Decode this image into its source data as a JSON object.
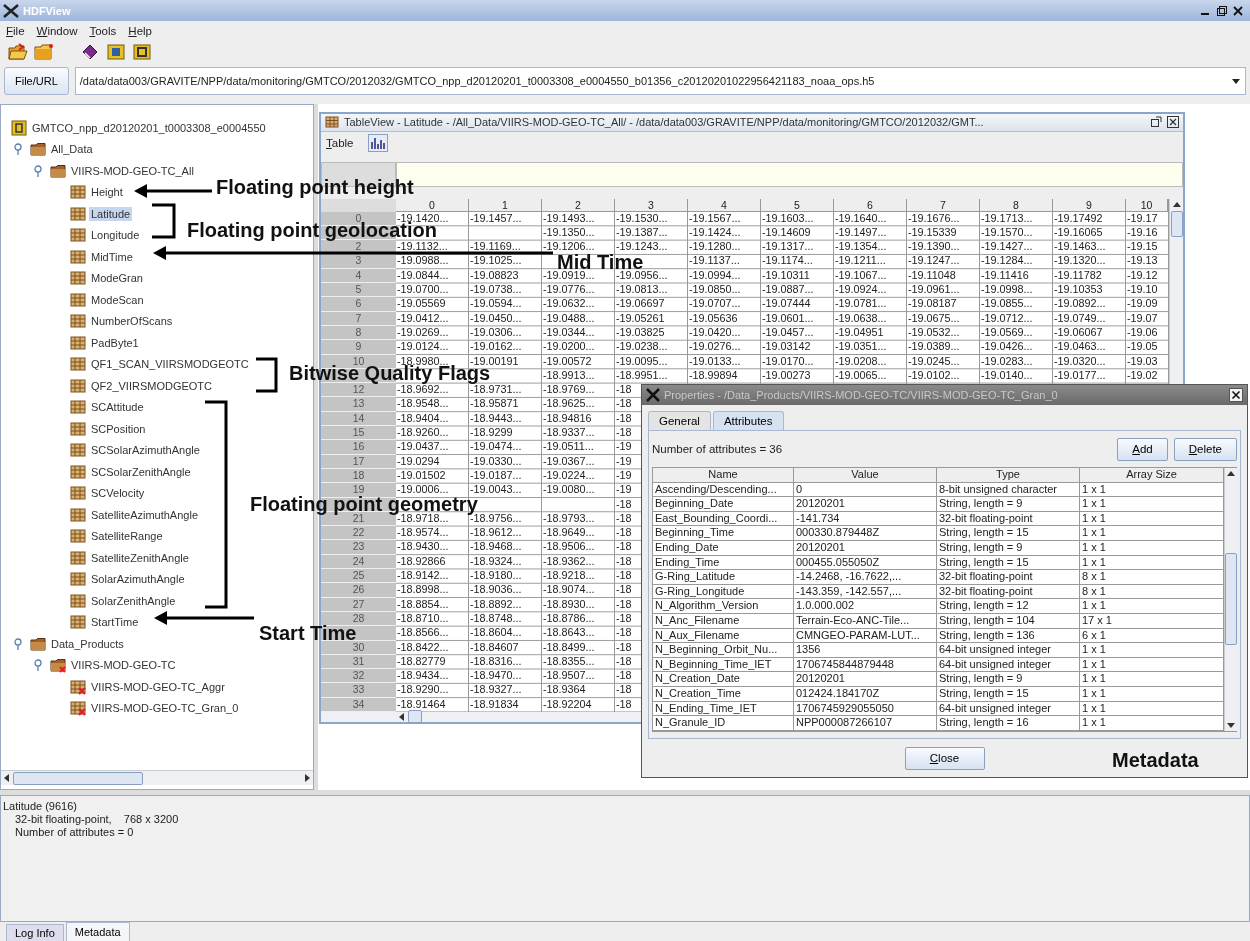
{
  "window": {
    "title": "HDFView"
  },
  "menu": [
    "File",
    "Window",
    "Tools",
    "Help"
  ],
  "file_url": {
    "label": "File/URL",
    "value": "/data/data003/GRAVITE/NPP/data/monitoring/GMTCO/2012032/GMTCO_npp_d20120201_t0003308_e0004550_b01356_c20120201022956421183_noaa_ops.h5"
  },
  "tree": {
    "items": [
      {
        "label": "GMTCO_npp_d20120201_t0003308_e0004550",
        "kind": "file",
        "selected": false,
        "children": [
          {
            "label": "All_Data",
            "kind": "group",
            "expanded": true,
            "selected": false,
            "children": [
              {
                "label": "VIIRS-MOD-GEO-TC_All",
                "kind": "group",
                "expanded": true,
                "selected": false,
                "children": [
                  {
                    "label": "Height",
                    "kind": "dataset",
                    "selected": false
                  },
                  {
                    "label": "Latitude",
                    "kind": "dataset",
                    "selected": true
                  },
                  {
                    "label": "Longitude",
                    "kind": "dataset",
                    "selected": false
                  },
                  {
                    "label": "MidTime",
                    "kind": "dataset",
                    "selected": false
                  },
                  {
                    "label": "ModeGran",
                    "kind": "dataset",
                    "selected": false
                  },
                  {
                    "label": "ModeScan",
                    "kind": "dataset",
                    "selected": false
                  },
                  {
                    "label": "NumberOfScans",
                    "kind": "dataset",
                    "selected": false
                  },
                  {
                    "label": "PadByte1",
                    "kind": "dataset",
                    "selected": false
                  },
                  {
                    "label": "QF1_SCAN_VIIRSMODGEOTC",
                    "kind": "dataset",
                    "selected": false
                  },
                  {
                    "label": "QF2_VIIRSMODGEOTC",
                    "kind": "dataset",
                    "selected": false
                  },
                  {
                    "label": "SCAttitude",
                    "kind": "dataset",
                    "selected": false
                  },
                  {
                    "label": "SCPosition",
                    "kind": "dataset",
                    "selected": false
                  },
                  {
                    "label": "SCSolarAzimuthAngle",
                    "kind": "dataset",
                    "selected": false
                  },
                  {
                    "label": "SCSolarZenithAngle",
                    "kind": "dataset",
                    "selected": false
                  },
                  {
                    "label": "SCVelocity",
                    "kind": "dataset",
                    "selected": false
                  },
                  {
                    "label": "SatelliteAzimuthAngle",
                    "kind": "dataset",
                    "selected": false
                  },
                  {
                    "label": "SatelliteRange",
                    "kind": "dataset",
                    "selected": false
                  },
                  {
                    "label": "SatelliteZenithAngle",
                    "kind": "dataset",
                    "selected": false
                  },
                  {
                    "label": "SolarAzimuthAngle",
                    "kind": "dataset",
                    "selected": false
                  },
                  {
                    "label": "SolarZenithAngle",
                    "kind": "dataset",
                    "selected": false
                  },
                  {
                    "label": "StartTime",
                    "kind": "dataset",
                    "selected": false
                  }
                ]
              }
            ]
          },
          {
            "label": "Data_Products",
            "kind": "group",
            "expanded": true,
            "selected": false,
            "children": [
              {
                "label": "VIIRS-MOD-GEO-TC",
                "kind": "linkgroup",
                "expanded": true,
                "selected": false,
                "children": [
                  {
                    "label": "VIIRS-MOD-GEO-TC_Aggr",
                    "kind": "reference",
                    "selected": false
                  },
                  {
                    "label": "VIIRS-MOD-GEO-TC_Gran_0",
                    "kind": "reference",
                    "selected": false
                  }
                ]
              }
            ]
          }
        ]
      }
    ]
  },
  "table_view": {
    "title": "TableView - Latitude - /All_Data/VIIRS-MOD-GEO-TC_All/ - /data/data003/GRAVITE/NPP/data/monitoring/GMTCO/2012032/GMT...",
    "menu": "Table",
    "columns": [
      "0",
      "1",
      "2",
      "3",
      "4",
      "5",
      "6",
      "7",
      "8",
      "9",
      "10"
    ],
    "rows": [
      {
        "label": "0",
        "cells": [
          "-19.1420...",
          "-19.1457...",
          "-19.1493...",
          "-19.1530...",
          "-19.1567...",
          "-19.1603...",
          "-19.1640...",
          "-19.1676...",
          "-19.1713...",
          "-19.17492",
          "-19.17"
        ]
      },
      {
        "label": null,
        "cells": [
          null,
          null,
          "-19.1350...",
          "-19.1387...",
          "-19.1424...",
          "-19.14609",
          "-19.1497...",
          "-19.15339",
          "-19.1570...",
          "-19.16065",
          "-19.16"
        ]
      },
      {
        "label": "2",
        "cells": [
          "-19.1132...",
          "-19.1169...",
          "-19.1206...",
          "-19.1243...",
          "-19.1280...",
          "-19.1317...",
          "-19.1354...",
          "-19.1390...",
          "-19.1427...",
          "-19.1463...",
          "-19.15"
        ]
      },
      {
        "label": "3",
        "cells": [
          "-19.0988...",
          "-19.1025...",
          null,
          null,
          "-19.1137...",
          "-19.1174...",
          "-19.1211...",
          "-19.1247...",
          "-19.1284...",
          "-19.1320...",
          "-19.13"
        ]
      },
      {
        "label": "4",
        "cells": [
          "-19.0844...",
          "-19.08823",
          "-19.0919...",
          "-19.0956...",
          "-19.0994...",
          "-19.10311",
          "-19.1067...",
          "-19.11048",
          "-19.11416",
          "-19.11782",
          "-19.12"
        ]
      },
      {
        "label": "5",
        "cells": [
          "-19.0700...",
          "-19.0738...",
          "-19.0776...",
          "-19.0813...",
          "-19.0850...",
          "-19.0887...",
          "-19.0924...",
          "-19.0961...",
          "-19.0998...",
          "-19.10353",
          "-19.10"
        ]
      },
      {
        "label": "6",
        "cells": [
          "-19.05569",
          "-19.0594...",
          "-19.0632...",
          "-19.06697",
          "-19.0707...",
          "-19.07444",
          "-19.0781...",
          "-19.08187",
          "-19.0855...",
          "-19.0892...",
          "-19.09"
        ]
      },
      {
        "label": "7",
        "cells": [
          "-19.0412...",
          "-19.0450...",
          "-19.0488...",
          "-19.05261",
          "-19.05636",
          "-19.0601...",
          "-19.0638...",
          "-19.0675...",
          "-19.0712...",
          "-19.0749...",
          "-19.07"
        ]
      },
      {
        "label": "8",
        "cells": [
          "-19.0269...",
          "-19.0306...",
          "-19.0344...",
          "-19.03825",
          "-19.0420...",
          "-19.0457...",
          "-19.04951",
          "-19.0532...",
          "-19.0569...",
          "-19.06067",
          "-19.06"
        ]
      },
      {
        "label": "9",
        "cells": [
          "-19.0124...",
          "-19.0162...",
          "-19.0200...",
          "-19.0238...",
          "-19.0276...",
          "-19.03142",
          "-19.0351...",
          "-19.0389...",
          "-19.0426...",
          "-19.0463...",
          "-19.05"
        ]
      },
      {
        "label": "10",
        "cells": [
          "-18.9980...",
          "-19.00191",
          "-19.00572",
          "-19.0095...",
          "-19.0133...",
          "-19.0170...",
          "-19.0208...",
          "-19.0245...",
          "-19.0283...",
          "-19.0320...",
          "-19.03"
        ]
      },
      {
        "label": null,
        "cells": [
          null,
          null,
          "-18.9913...",
          "-18.9951...",
          "-18.99894",
          "-19.00273",
          "-19.0065...",
          "-19.0102...",
          "-19.0140...",
          "-19.0177...",
          "-19.02"
        ]
      },
      {
        "label": "12",
        "cells": [
          "-18.9692...",
          "-18.9731...",
          "-18.9769...",
          "-18",
          null,
          null,
          null,
          null,
          null,
          null,
          null
        ]
      },
      {
        "label": "13",
        "cells": [
          "-18.9548...",
          "-18.95871",
          "-18.9625...",
          "-18",
          null,
          null,
          null,
          null,
          null,
          null,
          null
        ]
      },
      {
        "label": "14",
        "cells": [
          "-18.9404...",
          "-18.9443...",
          "-18.94816",
          "-18",
          null,
          null,
          null,
          null,
          null,
          null,
          null
        ]
      },
      {
        "label": "15",
        "cells": [
          "-18.9260...",
          "-18.9299",
          "-18.9337...",
          "-18",
          null,
          null,
          null,
          null,
          null,
          null,
          null
        ]
      },
      {
        "label": "16",
        "cells": [
          "-19.0437...",
          "-19.0474...",
          "-19.0511...",
          "-19",
          null,
          null,
          null,
          null,
          null,
          null,
          null
        ]
      },
      {
        "label": "17",
        "cells": [
          "-19.0294",
          "-19.0330...",
          "-19.0367...",
          "-19",
          null,
          null,
          null,
          null,
          null,
          null,
          null
        ]
      },
      {
        "label": "18",
        "cells": [
          "-19.01502",
          "-19.0187...",
          "-19.0224...",
          "-19",
          null,
          null,
          null,
          null,
          null,
          null,
          null
        ]
      },
      {
        "label": "19",
        "cells": [
          "-19.0006...",
          "-19.0043...",
          "-19.0080...",
          "-19",
          null,
          null,
          null,
          null,
          null,
          null,
          null
        ]
      },
      {
        "label": null,
        "cells": [
          null,
          null,
          null,
          "-18",
          null,
          null,
          null,
          null,
          null,
          null,
          null
        ]
      },
      {
        "label": "21",
        "cells": [
          "-18.9718...",
          "-18.9756...",
          "-18.9793...",
          "-18",
          null,
          null,
          null,
          null,
          null,
          null,
          null
        ]
      },
      {
        "label": "22",
        "cells": [
          "-18.9574...",
          "-18.9612...",
          "-18.9649...",
          "-18",
          null,
          null,
          null,
          null,
          null,
          null,
          null
        ]
      },
      {
        "label": "23",
        "cells": [
          "-18.9430...",
          "-18.9468...",
          "-18.9506...",
          "-18",
          null,
          null,
          null,
          null,
          null,
          null,
          null
        ]
      },
      {
        "label": "24",
        "cells": [
          "-18.92866",
          "-18.9324...",
          "-18.9362...",
          "-18",
          null,
          null,
          null,
          null,
          null,
          null,
          null
        ]
      },
      {
        "label": "25",
        "cells": [
          "-18.9142...",
          "-18.9180...",
          "-18.9218...",
          "-18",
          null,
          null,
          null,
          null,
          null,
          null,
          null
        ]
      },
      {
        "label": "26",
        "cells": [
          "-18.8998...",
          "-18.9036...",
          "-18.9074...",
          "-18",
          null,
          null,
          null,
          null,
          null,
          null,
          null
        ]
      },
      {
        "label": "27",
        "cells": [
          "-18.8854...",
          "-18.8892...",
          "-18.8930...",
          "-18",
          null,
          null,
          null,
          null,
          null,
          null,
          null
        ]
      },
      {
        "label": "28",
        "cells": [
          "-18.8710...",
          "-18.8748...",
          "-18.8786...",
          "-18",
          null,
          null,
          null,
          null,
          null,
          null,
          null
        ]
      },
      {
        "label": null,
        "cells": [
          "-18.8566...",
          "-18.8604...",
          "-18.8643...",
          "-18",
          null,
          null,
          null,
          null,
          null,
          null,
          null
        ]
      },
      {
        "label": "30",
        "cells": [
          "-18.8422...",
          "-18.84607",
          "-18.8499...",
          "-18",
          null,
          null,
          null,
          null,
          null,
          null,
          null
        ]
      },
      {
        "label": "31",
        "cells": [
          "-18.82779",
          "-18.8316...",
          "-18.8355...",
          "-18",
          null,
          null,
          null,
          null,
          null,
          null,
          null
        ]
      },
      {
        "label": "32",
        "cells": [
          "-18.9434...",
          "-18.9470...",
          "-18.9507...",
          "-18",
          null,
          null,
          null,
          null,
          null,
          null,
          null
        ]
      },
      {
        "label": "33",
        "cells": [
          "-18.9290...",
          "-18.9327...",
          "-18.9364",
          "-18",
          null,
          null,
          null,
          null,
          null,
          null,
          null
        ]
      },
      {
        "label": "34",
        "cells": [
          "-18.91464",
          "-18.91834",
          "-18.92204",
          "-18",
          null,
          null,
          null,
          null,
          null,
          null,
          null
        ]
      }
    ]
  },
  "properties": {
    "title": "Properties - /Data_Products/VIIRS-MOD-GEO-TC/VIIRS-MOD-GEO-TC_Gran_0",
    "tabs": [
      {
        "label": "General",
        "selected": false
      },
      {
        "label": "Attributes",
        "selected": true
      }
    ],
    "count": "Number of attributes = 36",
    "buttons": [
      "Add",
      "Delete"
    ],
    "columns": [
      "Name",
      "Value",
      "Type",
      "Array Size"
    ],
    "rows": [
      [
        "Ascending/Descending...",
        "0",
        "8-bit unsigned character",
        "1 x 1"
      ],
      [
        "Beginning_Date",
        "20120201",
        "String, length = 9",
        "1 x 1"
      ],
      [
        "East_Bounding_Coordi...",
        "-141.734",
        "32-bit floating-point",
        "1 x 1"
      ],
      [
        "Beginning_Time",
        "000330.879448Z",
        "String, length = 15",
        "1 x 1"
      ],
      [
        "Ending_Date",
        "20120201",
        "String, length = 9",
        "1 x 1"
      ],
      [
        "Ending_Time",
        "000455.055050Z",
        "String, length = 15",
        "1 x 1"
      ],
      [
        "G-Ring_Latitude",
        "-14.2468, -16.7622,...",
        "32-bit floating-point",
        "8 x 1"
      ],
      [
        "G-Ring_Longitude",
        "-143.359, -142.557,...",
        "32-bit floating-point",
        "8 x 1"
      ],
      [
        "N_Algorithm_Version",
        "1.0.000.002",
        "String, length = 12",
        "1 x 1"
      ],
      [
        "N_Anc_Filename",
        "Terrain-Eco-ANC-Tile...",
        "String, length = 104",
        "17 x 1"
      ],
      [
        "N_Aux_Filename",
        "CMNGEO-PARAM-LUT...",
        "String, length = 136",
        "6 x 1"
      ],
      [
        "N_Beginning_Orbit_Nu...",
        "1356",
        "64-bit unsigned integer",
        "1 x 1"
      ],
      [
        "N_Beginning_Time_IET",
        "1706745844879448",
        "64-bit unsigned integer",
        "1 x 1"
      ],
      [
        "N_Creation_Date",
        "20120201",
        "String, length = 9",
        "1 x 1"
      ],
      [
        "N_Creation_Time",
        "012424.184170Z",
        "String, length = 15",
        "1 x 1"
      ],
      [
        "N_Ending_Time_IET",
        "1706745929055050",
        "64-bit unsigned integer",
        "1 x 1"
      ],
      [
        "N_Granule_ID",
        "NPP000087266107",
        "String, length = 16",
        "1 x 1"
      ]
    ],
    "close": "Close"
  },
  "info": {
    "lines": [
      "Latitude (9616)",
      "32-bit floating-point,    768 x 3200",
      "Number of attributes = 0"
    ]
  },
  "bottom_tabs": [
    {
      "label": "Log Info",
      "selected": false
    },
    {
      "label": "Metadata",
      "selected": true
    }
  ],
  "annotations": [
    {
      "text": "Floating point height",
      "kind": "arrow"
    },
    {
      "text": "Floating point geolocation",
      "kind": "bracket"
    },
    {
      "text": "Mid Time",
      "kind": "arrow"
    },
    {
      "text": "Bitwise Quality Flags",
      "kind": "bracket"
    },
    {
      "text": "Floating point geometry",
      "kind": "bracket"
    },
    {
      "text": "Start Time",
      "kind": "arrow"
    },
    {
      "text": "Metadata",
      "kind": "label"
    }
  ]
}
